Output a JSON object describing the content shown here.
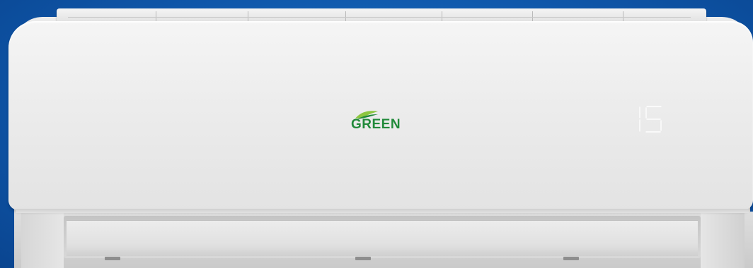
{
  "product": {
    "brand_logo_text": "GREEN",
    "display_value": "15",
    "colors": {
      "background": "#1060b0",
      "panel": "#ececec",
      "logo_green": "#218a3a",
      "logo_leaf_light": "#8dc63f",
      "display_digits": "#ffffff"
    }
  }
}
